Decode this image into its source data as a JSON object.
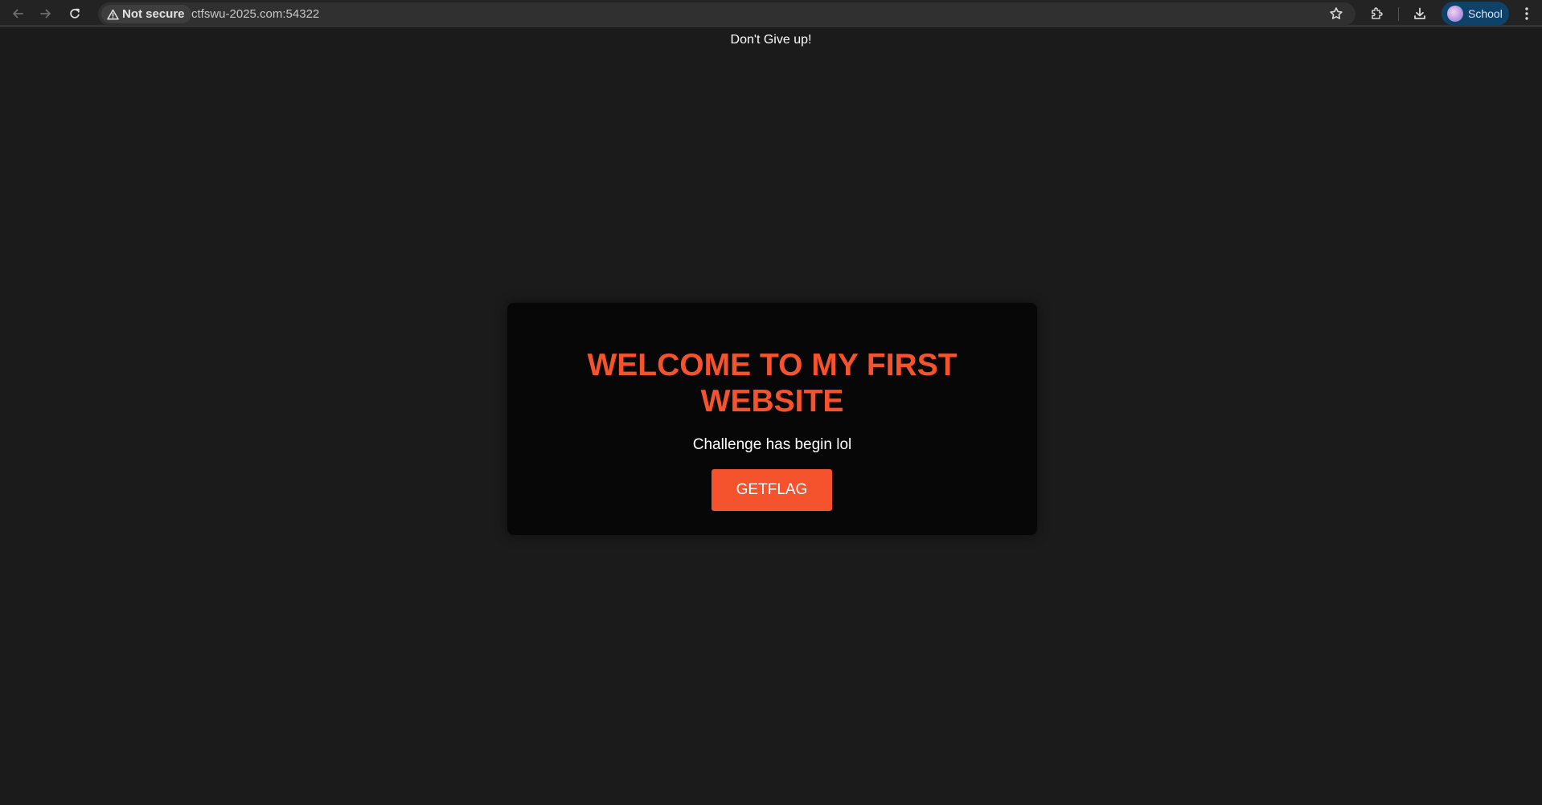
{
  "browser": {
    "security_label": "Not secure",
    "url": "ctfswu-2025.com:54322",
    "profile_name": "School"
  },
  "page": {
    "top_text": "Don't Give up!",
    "card": {
      "title": "WELCOME TO MY FIRST WEBSITE",
      "subtitle": "Challenge has begin lol",
      "button_label": "GETFLAG"
    }
  },
  "colors": {
    "accent": "#f5522e",
    "page_background": "#1b1b1b",
    "card_background": "#070707",
    "profile_chip": "#0e4268"
  },
  "icons": [
    "back-arrow-icon",
    "forward-arrow-icon",
    "reload-icon",
    "warning-icon",
    "star-icon",
    "extensions-icon",
    "download-icon",
    "avatar",
    "more-vert-icon"
  ]
}
